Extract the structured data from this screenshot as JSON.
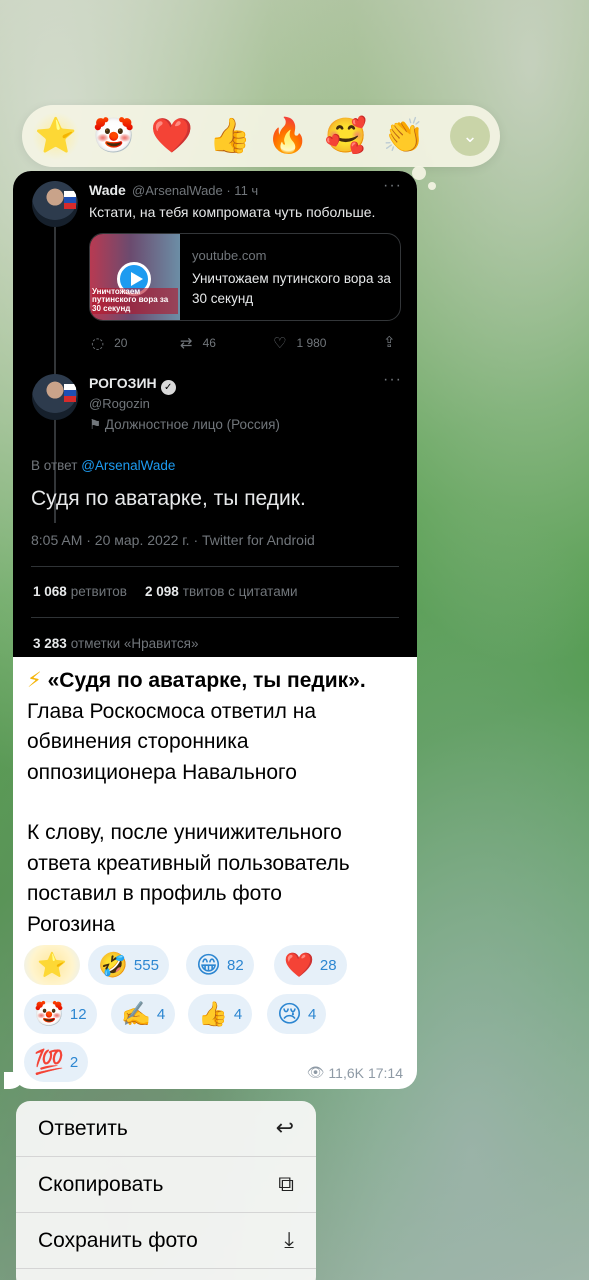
{
  "reaction_picker": {
    "items": [
      {
        "icon": "star-emoji",
        "glyph": "⭐"
      },
      {
        "icon": "clown-face-emoji",
        "glyph": "🤡"
      },
      {
        "icon": "red-heart-emoji",
        "glyph": "❤️"
      },
      {
        "icon": "thumbs-up-emoji",
        "glyph": "👍"
      },
      {
        "icon": "fire-emoji",
        "glyph": "🔥"
      },
      {
        "icon": "smiling-face-with-hearts-emoji",
        "glyph": "🥰"
      },
      {
        "icon": "clapping-hands-emoji",
        "glyph": "👏"
      }
    ],
    "expand_glyph": "⌄"
  },
  "tweet1": {
    "name": "Wade",
    "handle": "@ArsenalWade · 11 ч",
    "text": "Кстати, на тебя компромата чуть побольше.",
    "card_caption": "Уничтожаем путинского вора за 30 секунд",
    "card_domain": "youtube.com",
    "card_title": "Уничтожаем путинского вора за 30 секунд",
    "replies": "20",
    "retweets": "46",
    "likes": "1 980"
  },
  "tweet2": {
    "name": "РОГОЗИН",
    "handle": "@Rogozin",
    "official": "Должностное лицо (Россия)",
    "reply_prefix": "В ответ",
    "reply_mention": "@ArsenalWade",
    "text": "Судя по аватарке, ты педик.",
    "meta": "8:05 AM · 20 мар. 2022 г. · Twitter for Android",
    "retweets_count": "1 068",
    "retweets_label": "ретвитов",
    "quotes_count": "2 098",
    "quotes_label": "твитов с цитатами",
    "likes_count": "3 283",
    "likes_label": "отметки «Нравится»"
  },
  "caption": {
    "bolt": "⚡",
    "headline": "«Судя по аватарке, ты педик».",
    "para1": "Глава Роскосмоса ответил на\nобвинения сторонника\nоппозиционера Навального",
    "para2": "К слову, после уничижительного\nответа креативный пользователь\nпоставил в профиль фото\nРогозина"
  },
  "reactions": [
    {
      "icon": "star-emoji",
      "glyph": "⭐",
      "count": ""
    },
    {
      "icon": "rolling-laughing-emoji",
      "glyph": "🤣",
      "count": "555"
    },
    {
      "icon": "grinning-face-emoji",
      "glyph": "😁",
      "count": "82"
    },
    {
      "icon": "red-heart-emoji",
      "glyph": "❤️",
      "count": "28"
    },
    {
      "icon": "clown-face-emoji",
      "glyph": "🤡",
      "count": "12"
    },
    {
      "icon": "writing-hand-emoji",
      "glyph": "✍️",
      "count": "4"
    },
    {
      "icon": "thumbs-up-emoji",
      "glyph": "👍",
      "count": "4"
    },
    {
      "icon": "crying-face-emoji",
      "glyph": "😢",
      "count": "4"
    },
    {
      "icon": "hundred-points-emoji",
      "glyph": "💯",
      "count": "2"
    }
  ],
  "message_meta": {
    "views": "11,6K",
    "time": "17:14"
  },
  "context_menu": {
    "items": [
      {
        "label": "Ответить",
        "icon": "reply-arrow-icon"
      },
      {
        "label": "Скопировать",
        "icon": "copy-icon"
      },
      {
        "label": "Сохранить фото",
        "icon": "download-icon"
      }
    ]
  }
}
